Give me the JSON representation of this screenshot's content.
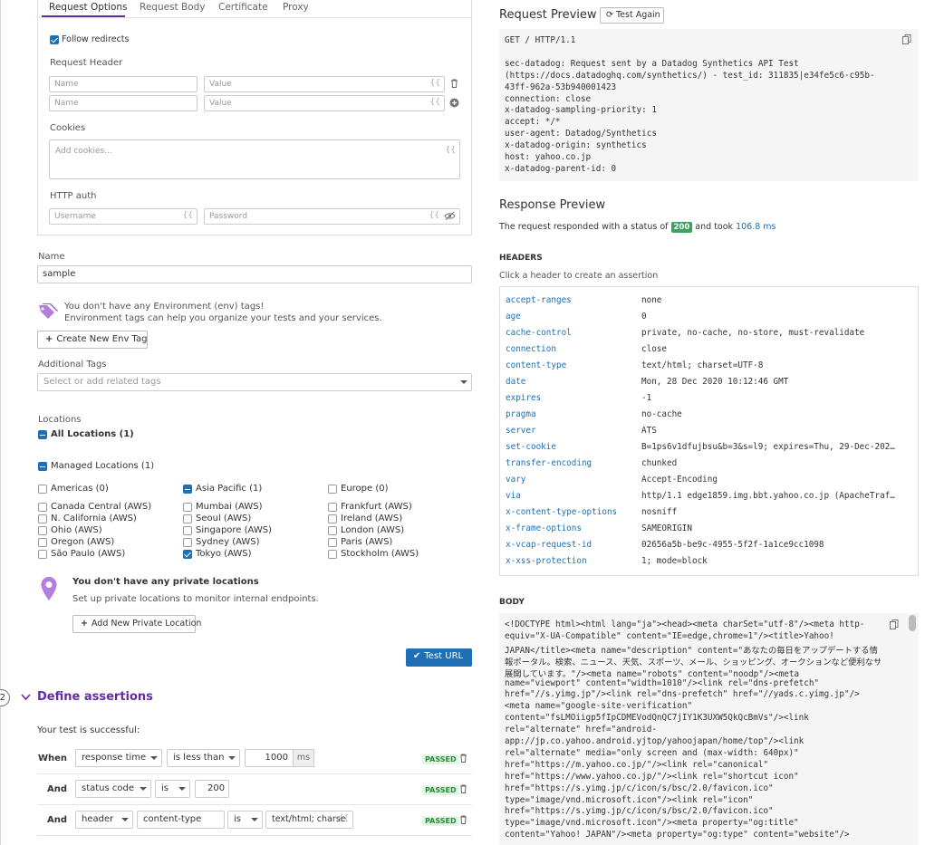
{
  "tabs": [
    "Request Options",
    "Request Body",
    "Certificate",
    "Proxy"
  ],
  "request_options": {
    "follow_redirects_label": "Follow redirects",
    "follow_redirects": true,
    "request_header_label": "Request Header",
    "header_rows": [
      {
        "name_placeholder": "Name",
        "value_placeholder": "Value",
        "action": "trash-icon"
      },
      {
        "name_placeholder": "Name",
        "value_placeholder": "Value",
        "action": "plus-circle-icon"
      }
    ],
    "cookies_label": "Cookies",
    "cookies_placeholder": "Add cookies...",
    "http_auth_label": "HTTP auth",
    "username_placeholder": "Username",
    "password_placeholder": "Password",
    "template_icon": "{{"
  },
  "name_section": {
    "label": "Name",
    "value": "sample"
  },
  "env_tags": {
    "line1": "You don't have any Environment (env) tags!",
    "line2": "Environment tags can help you organize your tests and your services.",
    "button": "Create New Env Tag"
  },
  "additional_tags": {
    "label": "Additional Tags",
    "placeholder": "Select or add related tags"
  },
  "locations": {
    "label": "Locations",
    "all": "All Locations (1)",
    "managed": "Managed Locations (1)",
    "groups": [
      {
        "title": "Americas (0)",
        "state": "unchecked",
        "items": [
          {
            "label": "Canada Central (AWS)",
            "checked": false
          },
          {
            "label": "N. California (AWS)",
            "checked": false
          },
          {
            "label": "Ohio (AWS)",
            "checked": false
          },
          {
            "label": "Oregon (AWS)",
            "checked": false
          },
          {
            "label": "São Paulo (AWS)",
            "checked": false
          }
        ]
      },
      {
        "title": "Asia Pacific (1)",
        "state": "partial",
        "items": [
          {
            "label": "Mumbai (AWS)",
            "checked": false
          },
          {
            "label": "Seoul (AWS)",
            "checked": false
          },
          {
            "label": "Singapore (AWS)",
            "checked": false
          },
          {
            "label": "Sydney (AWS)",
            "checked": false
          },
          {
            "label": "Tokyo (AWS)",
            "checked": true
          }
        ]
      },
      {
        "title": "Europe (0)",
        "state": "unchecked",
        "items": [
          {
            "label": "Frankfurt (AWS)",
            "checked": false
          },
          {
            "label": "Ireland (AWS)",
            "checked": false
          },
          {
            "label": "London (AWS)",
            "checked": false
          },
          {
            "label": "Paris (AWS)",
            "checked": false
          },
          {
            "label": "Stockholm (AWS)",
            "checked": false
          }
        ]
      }
    ],
    "private_title": "You don't have any private locations",
    "private_desc": "Set up private locations to monitor internal endpoints.",
    "private_button": "Add New Private Location"
  },
  "test_url_button": "Test URL",
  "step2": {
    "number": "2",
    "title": "Define assertions",
    "success_text": "Your test is successful:"
  },
  "assertions": [
    {
      "joiner": "When",
      "type": "response time",
      "operator": "is less than",
      "value": "1000",
      "unit": "ms",
      "status": "PASSED"
    },
    {
      "joiner": "And",
      "type": "status code",
      "operator": "is",
      "value": "200",
      "status": "PASSED"
    },
    {
      "joiner": "And",
      "type": "header",
      "property": "content-type",
      "operator": "is",
      "value": "text/html; charse",
      "status": "PASSED"
    }
  ],
  "request_preview": {
    "title": "Request Preview",
    "test_again": "Test Again",
    "lines": [
      "GET / HTTP/1.1",
      "",
      "sec-datadog: Request sent by a Datadog Synthetics API Test",
      "(https://docs.datadoghq.com/synthetics/) - test_id: 311835|e34fe5c6-c95b-",
      "43ff-962a-53b940001423",
      "connection: close",
      "x-datadog-sampling-priority: 1",
      "accept: */*",
      "user-agent: Datadog/Synthetics",
      "x-datadog-origin: synthetics",
      "host: yahoo.co.jp",
      "x-datadog-parent-id: 0"
    ]
  },
  "response_preview": {
    "title": "Response Preview",
    "status_prefix": "The request responded with a status of",
    "status_code": "200",
    "took": "and took",
    "duration": "106.8 ms"
  },
  "headers": {
    "title": "HEADERS",
    "hint": "Click a header to create an assertion",
    "rows": [
      [
        "accept-ranges",
        "none"
      ],
      [
        "age",
        "0"
      ],
      [
        "cache-control",
        "private, no-cache, no-store, must-revalidate"
      ],
      [
        "connection",
        "close"
      ],
      [
        "content-type",
        "text/html; charset=UTF-8"
      ],
      [
        "date",
        "Mon, 28 Dec 2020 10:12:46 GMT"
      ],
      [
        "expires",
        "-1"
      ],
      [
        "pragma",
        "no-cache"
      ],
      [
        "server",
        "ATS"
      ],
      [
        "set-cookie",
        "B=1ps6v1dfujbsu&b=3&s=l9; expires=Thu, 29-Dec-202…"
      ],
      [
        "transfer-encoding",
        "chunked"
      ],
      [
        "vary",
        "Accept-Encoding"
      ],
      [
        "via",
        "http/1.1 edge1859.img.bbt.yahoo.co.jp (ApacheTraf…"
      ],
      [
        "x-content-type-options",
        "nosniff"
      ],
      [
        "x-frame-options",
        "SAMEORIGIN"
      ],
      [
        "x-vcap-request-id",
        "02656a5b-be9c-4955-5f2f-1a1ce9cc1098"
      ],
      [
        "x-xss-protection",
        "1; mode=block"
      ]
    ]
  },
  "body": {
    "title": "BODY",
    "lines": [
      "<!DOCTYPE html><html lang=\"ja\"><head><meta charSet=\"utf-8\"/><meta http-",
      "equiv=\"X-UA-Compatible\" content=\"IE=edge,chrome=1\"/><title>Yahoo!",
      "JAPAN</title><meta name=\"description\" content=\"あなたの毎日をアップデートする情",
      "報ポータル。検索、ニュース、天気、スポーツ、メール、ショッピング、オークションなど便利なサービスを",
      "展開しています。\"/><meta name=\"robots\" content=\"noodp\"/><meta",
      "name=\"viewport\" content=\"width=1010\"/><link rel=\"dns-prefetch\"",
      "href=\"//s.yimg.jp\"/><link rel=\"dns-prefetch\" href=\"//yads.c.yimg.jp\"/>",
      "<meta name=\"google-site-verification\"",
      "content=\"fsLMOiigp5fIpCDMEVodQnQC7jIY1K3UXW5QkQcBmVs\"/><link",
      "rel=\"alternate\" href=\"android-",
      "app://jp.co.yahoo.android.yjtop/yahoojapan/home/top\"/><link",
      "rel=\"alternate\" media=\"only screen and (max-width: 640px)\"",
      "href=\"https://m.yahoo.co.jp/\"/><link rel=\"canonical\"",
      "href=\"https://www.yahoo.co.jp/\"/><link rel=\"shortcut icon\"",
      "href=\"https://s.yimg.jp/c/icon/s/bsc/2.0/favicon.ico\"",
      "type=\"image/vnd.microsoft.icon\"/><link rel=\"icon\"",
      "href=\"https://s.yimg.jp/c/icon/s/bsc/2.0/favicon.ico\"",
      "type=\"image/vnd.microsoft.icon\"/><meta property=\"og:title\"",
      "content=\"Yahoo! JAPAN\"/><meta property=\"og:type\" content=\"website\"/>"
    ]
  },
  "colors": {
    "accent": "#1c6fb8",
    "purple": "#632ca6",
    "passed": "#2a8a3a",
    "status_green": "#3aa35c"
  }
}
